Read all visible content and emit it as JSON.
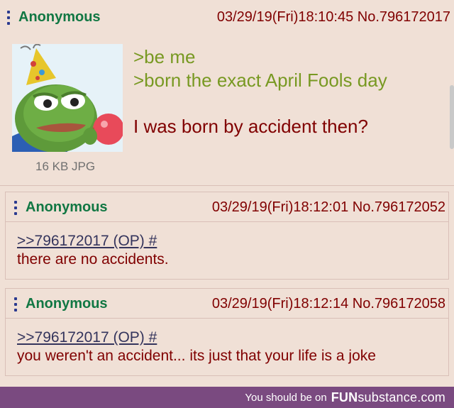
{
  "op": {
    "name": "Anonymous",
    "datetime": "03/29/19(Fri)18:10:45 No.796172017",
    "file_info": "16 KB JPG",
    "lines": [
      ">be me",
      ">born the exact April Fools day"
    ],
    "text": "I was born by accident then?"
  },
  "replies": [
    {
      "name": "Anonymous",
      "datetime": "03/29/19(Fri)18:12:01 No.796172052",
      "quote": ">>796172017 (OP) #",
      "text": "there are no accidents."
    },
    {
      "name": "Anonymous",
      "datetime": "03/29/19(Fri)18:12:14 No.796172058",
      "quote": ">>796172017 (OP) #",
      "text": "you weren't an accident... its just that your life is a joke"
    }
  ],
  "footer": {
    "prefix": "You should be on",
    "brand_bold": "FUN",
    "brand_rest": "substance",
    "brand_suffix": ".com"
  },
  "colors": {
    "post_bg": "#f0e0d6",
    "name": "#117743",
    "text": "#800000",
    "greentext": "#789922",
    "quotelink": "#34345c",
    "footer_bg": "#7a4a80"
  }
}
